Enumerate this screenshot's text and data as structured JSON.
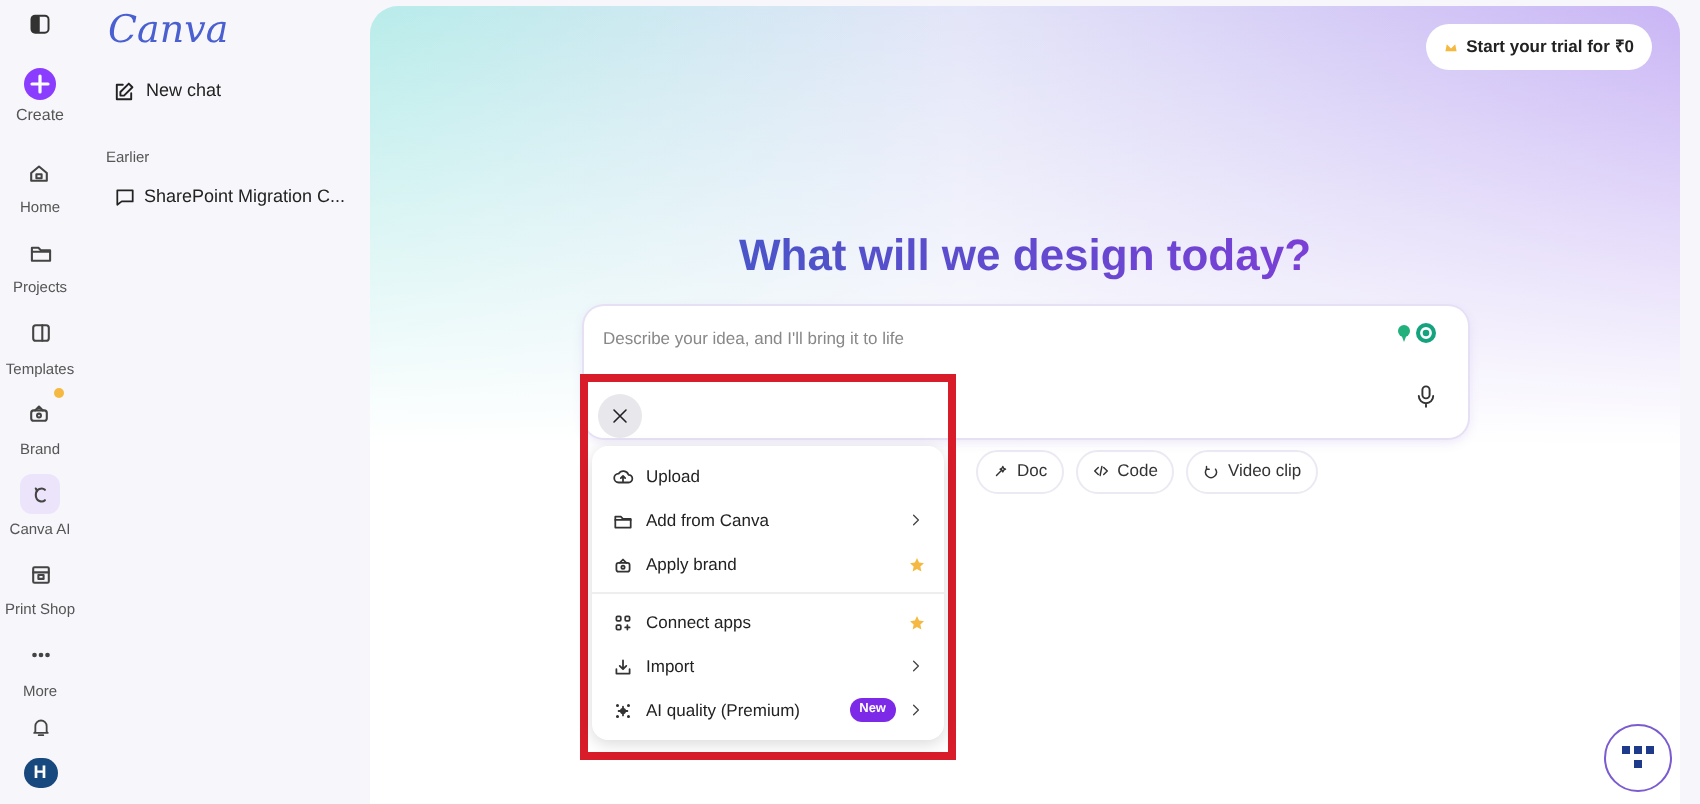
{
  "logo": "Canva",
  "rail": {
    "create": "Create",
    "items": [
      {
        "kind": "home",
        "label": "Home",
        "selected": false
      },
      {
        "kind": "folder",
        "label": "Projects",
        "selected": false
      },
      {
        "kind": "template",
        "label": "Templates",
        "selected": false
      },
      {
        "kind": "brand",
        "label": "Brand",
        "selected": false,
        "crown": true
      },
      {
        "kind": "ai",
        "label": "Canva AI",
        "selected": true
      },
      {
        "kind": "print",
        "label": "Print Shop",
        "selected": false
      },
      {
        "kind": "more",
        "label": "More",
        "selected": false
      }
    ],
    "avatar": "H"
  },
  "sidebar": {
    "new_chat": "New chat",
    "section": "Earlier",
    "chats": [
      "SharePoint Migration C..."
    ]
  },
  "trial_button": "Start your trial for ₹0",
  "heading": "What will we design today?",
  "prompt": {
    "placeholder": "Describe your idea, and I'll bring it to life"
  },
  "chips": [
    "Doc",
    "Code",
    "Video clip"
  ],
  "menu": {
    "groups": [
      [
        {
          "label": "Upload",
          "kind": "plain"
        },
        {
          "label": "Add from Canva",
          "kind": "chevron"
        },
        {
          "label": "Apply brand",
          "kind": "star"
        }
      ],
      [
        {
          "label": "Connect apps",
          "kind": "star"
        },
        {
          "label": "Import",
          "kind": "chevron"
        },
        {
          "label": "AI quality (Premium)",
          "kind": "badge",
          "badge": "New"
        }
      ]
    ]
  }
}
